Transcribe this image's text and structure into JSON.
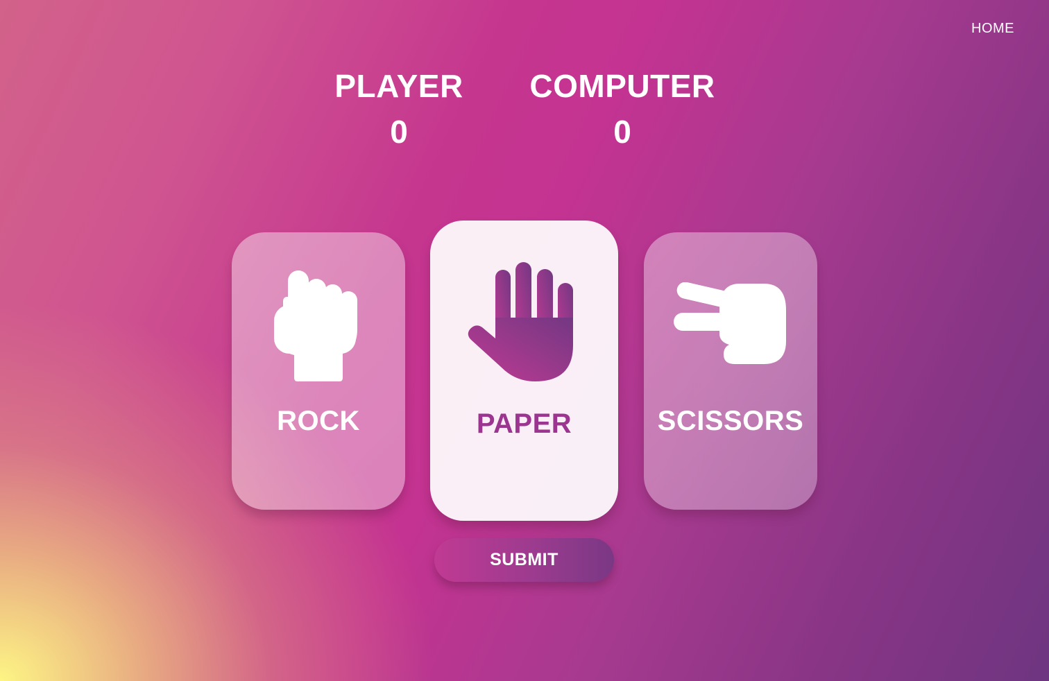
{
  "nav": {
    "home_label": "HOME"
  },
  "scoreboard": {
    "player_label": "PLAYER",
    "player_score": "0",
    "computer_label": "COMPUTER",
    "computer_score": "0"
  },
  "choices": [
    {
      "label": "ROCK",
      "icon": "fist-icon",
      "selected": false
    },
    {
      "label": "PAPER",
      "icon": "open-hand-icon",
      "selected": true
    },
    {
      "label": "SCISSORS",
      "icon": "two-fingers-icon",
      "selected": false
    }
  ],
  "submit": {
    "label": "SUBMIT"
  },
  "colors": {
    "accent": "#9b3590",
    "background_pink": "#c43391",
    "background_purple": "#6e3580",
    "background_yellow": "#fdf584"
  }
}
